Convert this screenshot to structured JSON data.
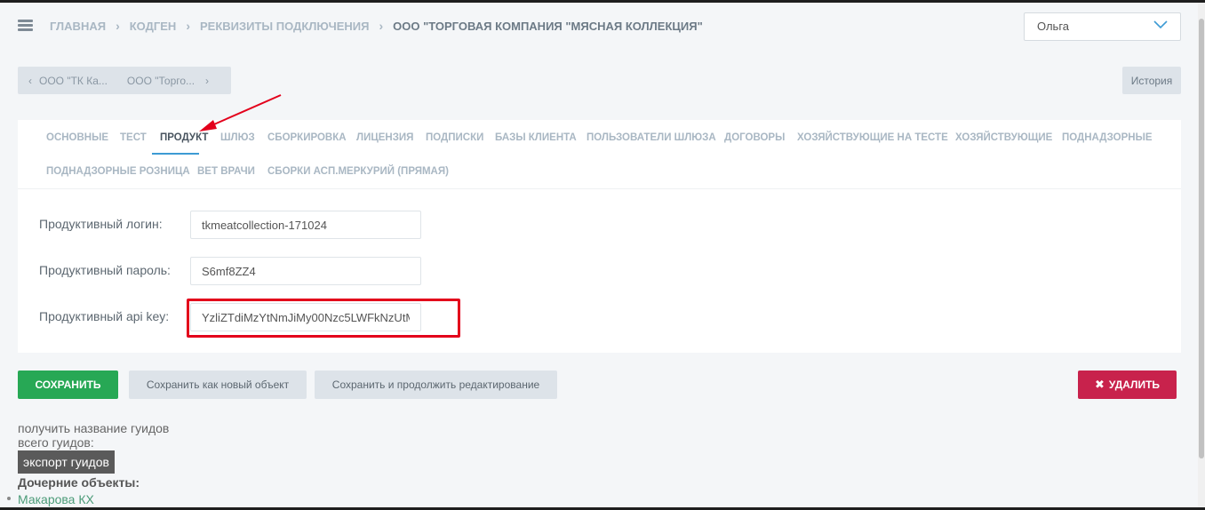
{
  "header": {
    "breadcrumbs": [
      "Главная",
      "Кодген",
      "Реквизиты подключения"
    ],
    "current": "ООО \"Торговая компания \"Мясная коллекция\"",
    "user": "Ольга"
  },
  "object_nav": {
    "prev_label": "ООО \"ТК Ка...",
    "next_label": "ООО \"Торго..."
  },
  "history_label": "История",
  "tabs": [
    "Основные",
    "Тест",
    "Продукт",
    "Шлюз",
    "Сборкировка",
    "Лицензия",
    "Подписки",
    "Базы клиента",
    "Пользователи шлюза",
    "Договоры",
    "Хозяйствующие на тесте",
    "Хозяйствующие",
    "Поднадзорные",
    "Поднадзорные розница",
    "Вет врачи",
    "Сборки асп.Меркурий (прямая)"
  ],
  "active_tab": "Продукт",
  "form": {
    "login": {
      "label": "Продуктивный логин:",
      "value": "tkmeatcollection-171024"
    },
    "password": {
      "label": "Продуктивный пароль:",
      "value": "S6mf8ZZ4"
    },
    "api_key": {
      "label": "Продуктивный api key:",
      "value": "YzliZTdiMzYtNmJiMy00Nzc5LWFkNzUtM"
    }
  },
  "buttons": {
    "save": "Сохранить",
    "save_new": "Сохранить как новый объект",
    "save_continue": "Сохранить и продолжить редактирование",
    "delete": "Удалить"
  },
  "guids": {
    "get_names": "получить название гуидов",
    "total": "всего гуидов:",
    "export": "экспорт гуидов"
  },
  "children": {
    "title": "Дочерние объекты:",
    "items": [
      "Макарова КХ"
    ]
  },
  "colors": {
    "save_green": "#27a855",
    "delete_red": "#c8224c",
    "annotation_red": "#e3001b",
    "active_tab_accent": "#3d9bd4"
  }
}
